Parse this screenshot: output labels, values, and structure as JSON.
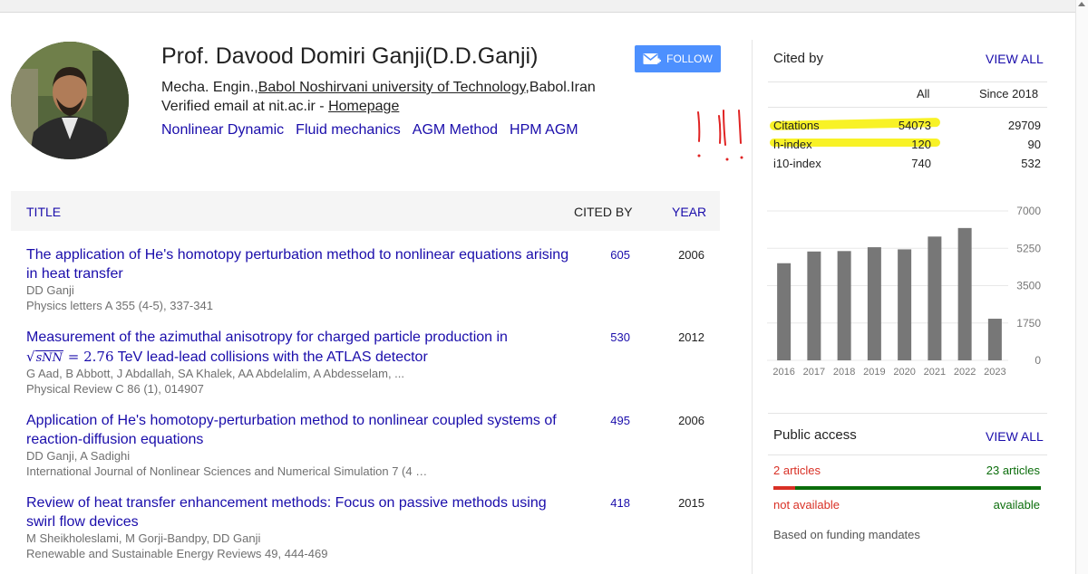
{
  "profile": {
    "name": "Prof. Davood Domiri Ganji(D.D.Ganji)",
    "affiliation_prefix": "Mecha. Engin.,",
    "affiliation_link": "Babol Noshirvani university of Technology",
    "affiliation_suffix": ",Babol.Iran",
    "email_text": "Verified email at nit.ac.ir - ",
    "homepage_link": "Homepage",
    "interests": [
      "Nonlinear Dynamic",
      "Fluid mechanics",
      "AGM Method",
      "HPM AGM"
    ],
    "follow_label": "FOLLOW"
  },
  "table": {
    "title_header": "TITLE",
    "cited_header": "CITED BY",
    "year_header": "YEAR",
    "rows": [
      {
        "title": "The application of He's homotopy perturbation method to nonlinear equations arising in heat transfer",
        "authors": "DD Ganji",
        "venue": "Physics letters A 355 (4-5), 337-341",
        "cited": "605",
        "year": "2006"
      },
      {
        "title_pre": "Measurement of the azimuthal anisotropy for charged particle production in",
        "math_radicand": "sNN",
        "math_rest": " = 2.76",
        "title_post": " TeV lead-lead collisions with the ATLAS detector",
        "authors": "G Aad, B Abbott, J Abdallah, SA Khalek, AA Abdelalim, A Abdesselam, ...",
        "venue": "Physical Review C 86 (1), 014907",
        "cited": "530",
        "year": "2012"
      },
      {
        "title": "Application of He's homotopy-perturbation method to nonlinear coupled systems of reaction-diffusion equations",
        "authors": "DD Ganji, A Sadighi",
        "venue": "International Journal of Nonlinear Sciences and Numerical Simulation 7 (4 …",
        "cited": "495",
        "year": "2006"
      },
      {
        "title": "Review of heat transfer enhancement methods: Focus on passive methods using swirl flow devices",
        "authors": "M Sheikholeslami, M Gorji-Bandpy, DD Ganji",
        "venue": "Renewable and Sustainable Energy Reviews 49, 444-469",
        "cited": "418",
        "year": "2015"
      }
    ]
  },
  "cited_by": {
    "title": "Cited by",
    "view_all": "VIEW ALL",
    "col_all": "All",
    "col_since": "Since 2018",
    "stats": [
      {
        "label": "Citations",
        "all": "54073",
        "since": "29709"
      },
      {
        "label": "h-index",
        "all": "120",
        "since": "90"
      },
      {
        "label": "i10-index",
        "all": "740",
        "since": "532"
      }
    ]
  },
  "chart_data": {
    "type": "bar",
    "categories": [
      "2016",
      "2017",
      "2018",
      "2019",
      "2020",
      "2021",
      "2022",
      "2023"
    ],
    "values": [
      4550,
      5100,
      5120,
      5300,
      5200,
      5800,
      6200,
      1950
    ],
    "yticks": [
      "7000",
      "5250",
      "3500",
      "1750",
      "0"
    ],
    "ylim": [
      0,
      7000
    ],
    "bar_color": "#777777"
  },
  "public_access": {
    "title": "Public access",
    "view_all": "VIEW ALL",
    "not_available_count": "2 articles",
    "available_count": "23 articles",
    "not_available_fraction": 0.08,
    "not_available_label": "not available",
    "available_label": "available",
    "note": "Based on funding mandates"
  }
}
